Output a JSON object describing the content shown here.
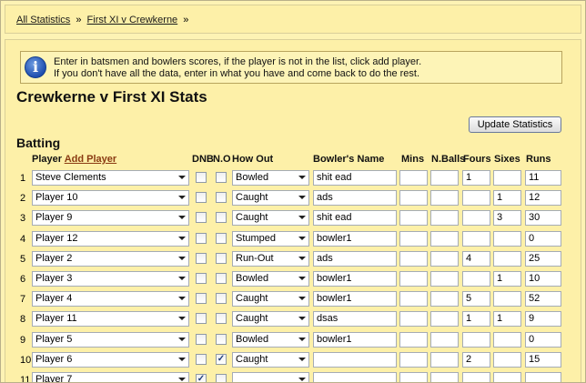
{
  "breadcrumb": {
    "items": [
      "All Statistics",
      "First XI v Crewkerne"
    ],
    "separator": "»"
  },
  "info": {
    "line1": "Enter in batsmen and bowlers scores, if the player is not in the list, click add player.",
    "line2": "If you don't have all the data, enter in what you have and come back to do the rest."
  },
  "page_title": "Crewkerne v First XI Stats",
  "update_button": "Update Statistics",
  "section_title": "Batting",
  "headers": {
    "player": "Player",
    "add_player": "Add Player",
    "dnb": "DNB",
    "no": "N.O",
    "how_out": "How Out",
    "bowler": "Bowler's Name",
    "mins": "Mins",
    "balls": "N.Balls",
    "fours": "Fours",
    "sixes": "Sixes",
    "runs": "Runs"
  },
  "rows": [
    {
      "n": "1",
      "player": "Steve Clements",
      "dnb": false,
      "no": false,
      "how": "Bowled",
      "bowler": "shit ead",
      "mins": "",
      "balls": "",
      "fours": "1",
      "sixes": "",
      "runs": "11"
    },
    {
      "n": "2",
      "player": "Player 10",
      "dnb": false,
      "no": false,
      "how": "Caught",
      "bowler": "ads",
      "mins": "",
      "balls": "",
      "fours": "",
      "sixes": "1",
      "runs": "12"
    },
    {
      "n": "3",
      "player": "Player 9",
      "dnb": false,
      "no": false,
      "how": "Caught",
      "bowler": "shit ead",
      "mins": "",
      "balls": "",
      "fours": "",
      "sixes": "3",
      "runs": "30"
    },
    {
      "n": "4",
      "player": "Player 12",
      "dnb": false,
      "no": false,
      "how": "Stumped",
      "bowler": "bowler1",
      "mins": "",
      "balls": "",
      "fours": "",
      "sixes": "",
      "runs": "0"
    },
    {
      "n": "5",
      "player": "Player 2",
      "dnb": false,
      "no": false,
      "how": "Run-Out",
      "bowler": "ads",
      "mins": "",
      "balls": "",
      "fours": "4",
      "sixes": "",
      "runs": "25"
    },
    {
      "n": "6",
      "player": "Player 3",
      "dnb": false,
      "no": false,
      "how": "Bowled",
      "bowler": "bowler1",
      "mins": "",
      "balls": "",
      "fours": "",
      "sixes": "1",
      "runs": "10"
    },
    {
      "n": "7",
      "player": "Player 4",
      "dnb": false,
      "no": false,
      "how": "Caught",
      "bowler": "bowler1",
      "mins": "",
      "balls": "",
      "fours": "5",
      "sixes": "",
      "runs": "52"
    },
    {
      "n": "8",
      "player": "Player 11",
      "dnb": false,
      "no": false,
      "how": "Caught",
      "bowler": "dsas",
      "mins": "",
      "balls": "",
      "fours": "1",
      "sixes": "1",
      "runs": "9"
    },
    {
      "n": "9",
      "player": "Player 5",
      "dnb": false,
      "no": false,
      "how": "Bowled",
      "bowler": "bowler1",
      "mins": "",
      "balls": "",
      "fours": "",
      "sixes": "",
      "runs": "0"
    },
    {
      "n": "10",
      "player": "Player 6",
      "dnb": false,
      "no": true,
      "how": "Caught",
      "bowler": "",
      "mins": "",
      "balls": "",
      "fours": "2",
      "sixes": "",
      "runs": "15"
    },
    {
      "n": "11",
      "player": "Player 7",
      "dnb": true,
      "no": false,
      "how": "",
      "bowler": "",
      "mins": "",
      "balls": "",
      "fours": "",
      "sixes": "",
      "runs": ""
    }
  ],
  "check_mark": "✓"
}
